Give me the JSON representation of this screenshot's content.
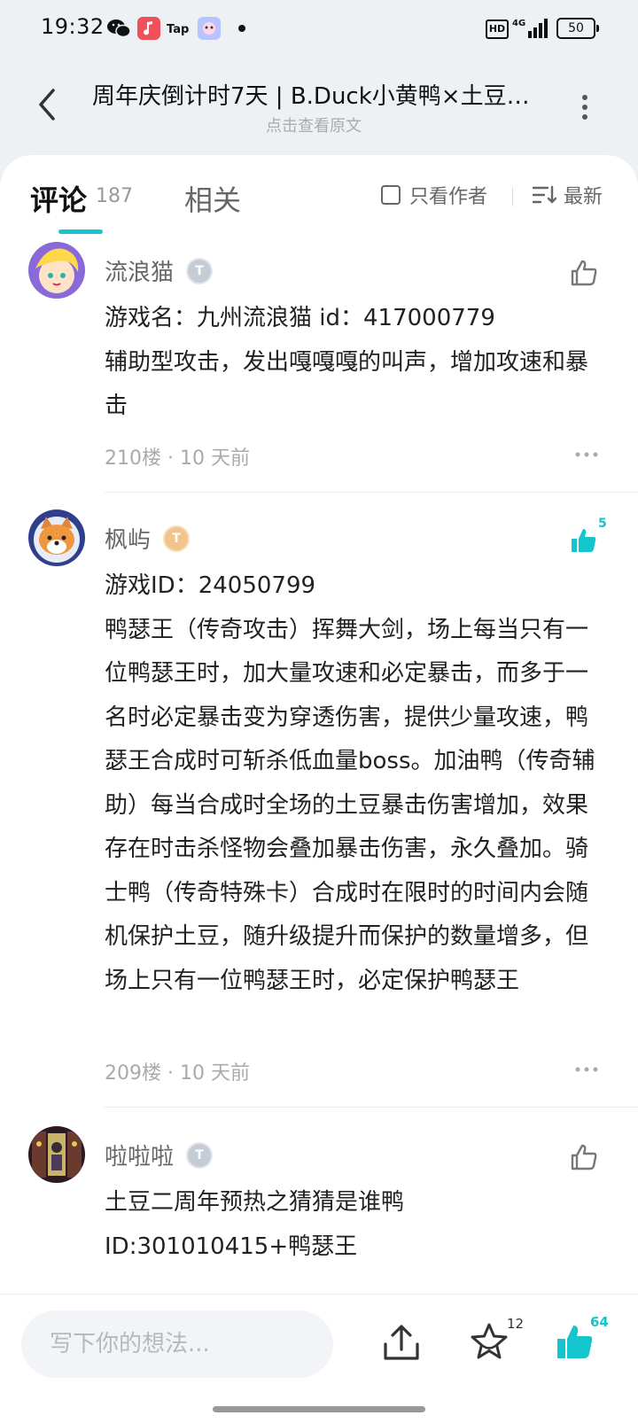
{
  "status_bar": {
    "time": "19:32",
    "hd": "HD",
    "network": "4G",
    "battery": "50"
  },
  "header": {
    "title": "周年庆倒计时7天 | B.Duck小黄鸭×土豆…",
    "subtitle": "点击查看原文"
  },
  "tabs": {
    "comments_label": "评论",
    "comments_count": "187",
    "related_label": "相关",
    "author_only_label": "只看作者",
    "sort_label": "最新"
  },
  "comments": [
    {
      "username": "流浪猫",
      "badge": "T",
      "lines": [
        "游戏名：九州流浪猫   id：417000779",
        "辅助型攻击，发出嘎嘎嘎的叫声，增加攻速和暴击"
      ],
      "meta": "210楼 · 10 天前",
      "likes": ""
    },
    {
      "username": "枫屿",
      "badge": "T",
      "lines": [
        "游戏ID：24050799",
        "鸭瑟王（传奇攻击）挥舞大剑，场上每当只有一位鸭瑟王时，加大量攻速和必定暴击，而多于一名时必定暴击变为穿透伤害，提供少量攻速，鸭瑟王合成时可斩杀低血量boss。加油鸭（传奇辅助）每当合成时全场的土豆暴击伤害增加，效果存在时击杀怪物会叠加暴击伤害，永久叠加。骑士鸭（传奇特殊卡）合成时在限时的时间内会随机保护土豆，随升级提升而保护的数量增多，但场上只有一位鸭瑟王时，必定保护鸭瑟王"
      ],
      "meta": "209楼 · 10 天前",
      "likes": "5"
    },
    {
      "username": "啦啦啦",
      "badge": "T",
      "lines": [
        "土豆二周年预热之猜猜是谁鸭",
        "ID:301010415+鸭瑟王"
      ],
      "meta": "",
      "likes": ""
    }
  ],
  "bottom_bar": {
    "input_placeholder": "写下你的想法...",
    "star_count": "12",
    "like_count": "64"
  },
  "colors": {
    "accent": "#15c5ce",
    "background": "#eef1f4"
  }
}
